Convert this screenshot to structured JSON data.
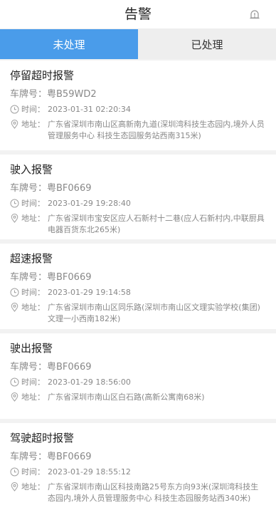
{
  "header": {
    "title": "告警",
    "alert_icon": "alert-icon"
  },
  "tabs": [
    {
      "label": "未处理",
      "active": true
    },
    {
      "label": "已处理",
      "active": false
    }
  ],
  "labels": {
    "plate": "车牌号：",
    "time": "时间：",
    "address": "地址："
  },
  "icons": {
    "time": "clock-icon",
    "address": "location-pin-icon"
  },
  "colors": {
    "accent": "#4a9cea",
    "tab_inactive_bg": "#eeeeee",
    "page_bg": "#f2f2f2",
    "secondary_text": "#888888"
  },
  "alarms": [
    {
      "type": "停留超时报警",
      "plate": "粤B59WD2",
      "time": "2023-01-31 02:20:34",
      "address": "广东省深圳市南山区高新南九道(深圳湾科技生态园内,境外人员管理服务中心 科技生态园服务站西南315米)"
    },
    {
      "type": "驶入报警",
      "plate": "粤BF0669",
      "time": "2023-01-29 19:28:40",
      "address": "广东省深圳市宝安区应人石新村十二巷(应人石新村内,中联厨具电器百货东北265米)"
    },
    {
      "type": "超速报警",
      "plate": "粤BF0669",
      "time": "2023-01-29 19:14:58",
      "address": "广东省深圳市南山区同乐路(深圳市南山区文理实验学校(集团)文理一小西南182米)"
    },
    {
      "type": "驶出报警",
      "plate": "粤BF0669",
      "time": "2023-01-29 18:56:00",
      "address": "广东省深圳市南山区白石路(高新公寓南68米)"
    },
    {
      "type": "驾驶超时报警",
      "plate": "粤BF0669",
      "time": "2023-01-29 18:55:12",
      "address": "广东省深圳市南山区科技南路25号东方向93米(深圳湾科技生态园内,境外人员管理服务中心 科技生态园服务站西340米)"
    }
  ]
}
